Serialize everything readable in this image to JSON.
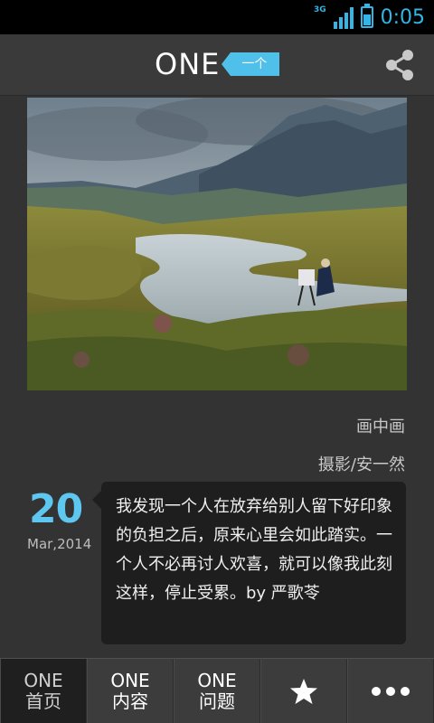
{
  "status_bar": {
    "network": "3G",
    "time": "0:05",
    "accent_color": "#33b5e5"
  },
  "header": {
    "logo_text": "ONE",
    "logo_tag": "一个",
    "share_icon": "share-icon"
  },
  "photo": {
    "title": "画中画",
    "credit": "摄影/安一然"
  },
  "date": {
    "day": "20",
    "month_year": "Mar,2014"
  },
  "quote": {
    "text": "我发现一个人在放弃给别人留下好印象的负担之后，原来心里会如此踏实。一个人不必再讨人欢喜，就可以像我此刻这样，停止受累。by 严歌苓"
  },
  "bottom_nav": {
    "items": [
      {
        "top": "ONE",
        "bottom": "首页"
      },
      {
        "top": "ONE",
        "bottom": "内容"
      },
      {
        "top": "ONE",
        "bottom": "问题"
      }
    ],
    "favorites_icon": "star-icon",
    "more_icon": "more-icon"
  }
}
